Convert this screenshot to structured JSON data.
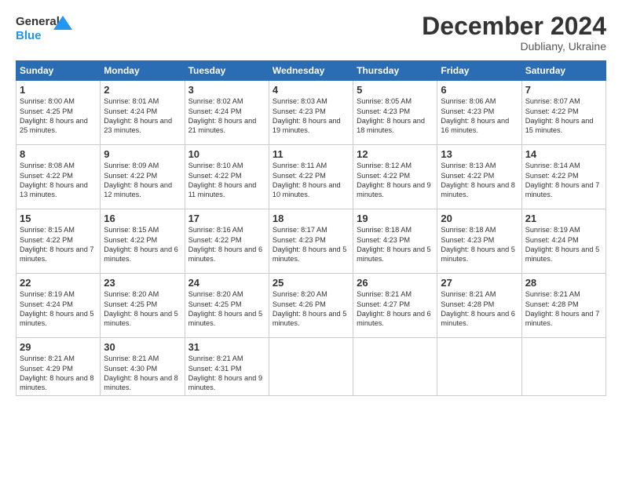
{
  "header": {
    "logo_general": "General",
    "logo_blue": "Blue",
    "month": "December 2024",
    "location": "Dubliany, Ukraine"
  },
  "days_of_week": [
    "Sunday",
    "Monday",
    "Tuesday",
    "Wednesday",
    "Thursday",
    "Friday",
    "Saturday"
  ],
  "weeks": [
    [
      {
        "day": "1",
        "sunrise": "8:00 AM",
        "sunset": "4:25 PM",
        "daylight": "8 hours and 25 minutes."
      },
      {
        "day": "2",
        "sunrise": "8:01 AM",
        "sunset": "4:24 PM",
        "daylight": "8 hours and 23 minutes."
      },
      {
        "day": "3",
        "sunrise": "8:02 AM",
        "sunset": "4:24 PM",
        "daylight": "8 hours and 21 minutes."
      },
      {
        "day": "4",
        "sunrise": "8:03 AM",
        "sunset": "4:23 PM",
        "daylight": "8 hours and 19 minutes."
      },
      {
        "day": "5",
        "sunrise": "8:05 AM",
        "sunset": "4:23 PM",
        "daylight": "8 hours and 18 minutes."
      },
      {
        "day": "6",
        "sunrise": "8:06 AM",
        "sunset": "4:23 PM",
        "daylight": "8 hours and 16 minutes."
      },
      {
        "day": "7",
        "sunrise": "8:07 AM",
        "sunset": "4:22 PM",
        "daylight": "8 hours and 15 minutes."
      }
    ],
    [
      {
        "day": "8",
        "sunrise": "8:08 AM",
        "sunset": "4:22 PM",
        "daylight": "8 hours and 13 minutes."
      },
      {
        "day": "9",
        "sunrise": "8:09 AM",
        "sunset": "4:22 PM",
        "daylight": "8 hours and 12 minutes."
      },
      {
        "day": "10",
        "sunrise": "8:10 AM",
        "sunset": "4:22 PM",
        "daylight": "8 hours and 11 minutes."
      },
      {
        "day": "11",
        "sunrise": "8:11 AM",
        "sunset": "4:22 PM",
        "daylight": "8 hours and 10 minutes."
      },
      {
        "day": "12",
        "sunrise": "8:12 AM",
        "sunset": "4:22 PM",
        "daylight": "8 hours and 9 minutes."
      },
      {
        "day": "13",
        "sunrise": "8:13 AM",
        "sunset": "4:22 PM",
        "daylight": "8 hours and 8 minutes."
      },
      {
        "day": "14",
        "sunrise": "8:14 AM",
        "sunset": "4:22 PM",
        "daylight": "8 hours and 7 minutes."
      }
    ],
    [
      {
        "day": "15",
        "sunrise": "8:15 AM",
        "sunset": "4:22 PM",
        "daylight": "8 hours and 7 minutes."
      },
      {
        "day": "16",
        "sunrise": "8:15 AM",
        "sunset": "4:22 PM",
        "daylight": "8 hours and 6 minutes."
      },
      {
        "day": "17",
        "sunrise": "8:16 AM",
        "sunset": "4:22 PM",
        "daylight": "8 hours and 6 minutes."
      },
      {
        "day": "18",
        "sunrise": "8:17 AM",
        "sunset": "4:23 PM",
        "daylight": "8 hours and 5 minutes."
      },
      {
        "day": "19",
        "sunrise": "8:18 AM",
        "sunset": "4:23 PM",
        "daylight": "8 hours and 5 minutes."
      },
      {
        "day": "20",
        "sunrise": "8:18 AM",
        "sunset": "4:23 PM",
        "daylight": "8 hours and 5 minutes."
      },
      {
        "day": "21",
        "sunrise": "8:19 AM",
        "sunset": "4:24 PM",
        "daylight": "8 hours and 5 minutes."
      }
    ],
    [
      {
        "day": "22",
        "sunrise": "8:19 AM",
        "sunset": "4:24 PM",
        "daylight": "8 hours and 5 minutes."
      },
      {
        "day": "23",
        "sunrise": "8:20 AM",
        "sunset": "4:25 PM",
        "daylight": "8 hours and 5 minutes."
      },
      {
        "day": "24",
        "sunrise": "8:20 AM",
        "sunset": "4:25 PM",
        "daylight": "8 hours and 5 minutes."
      },
      {
        "day": "25",
        "sunrise": "8:20 AM",
        "sunset": "4:26 PM",
        "daylight": "8 hours and 5 minutes."
      },
      {
        "day": "26",
        "sunrise": "8:21 AM",
        "sunset": "4:27 PM",
        "daylight": "8 hours and 6 minutes."
      },
      {
        "day": "27",
        "sunrise": "8:21 AM",
        "sunset": "4:28 PM",
        "daylight": "8 hours and 6 minutes."
      },
      {
        "day": "28",
        "sunrise": "8:21 AM",
        "sunset": "4:28 PM",
        "daylight": "8 hours and 7 minutes."
      }
    ],
    [
      {
        "day": "29",
        "sunrise": "8:21 AM",
        "sunset": "4:29 PM",
        "daylight": "8 hours and 8 minutes."
      },
      {
        "day": "30",
        "sunrise": "8:21 AM",
        "sunset": "4:30 PM",
        "daylight": "8 hours and 8 minutes."
      },
      {
        "day": "31",
        "sunrise": "8:21 AM",
        "sunset": "4:31 PM",
        "daylight": "8 hours and 9 minutes."
      },
      null,
      null,
      null,
      null
    ]
  ],
  "labels": {
    "sunrise": "Sunrise:",
    "sunset": "Sunset:",
    "daylight": "Daylight:"
  }
}
